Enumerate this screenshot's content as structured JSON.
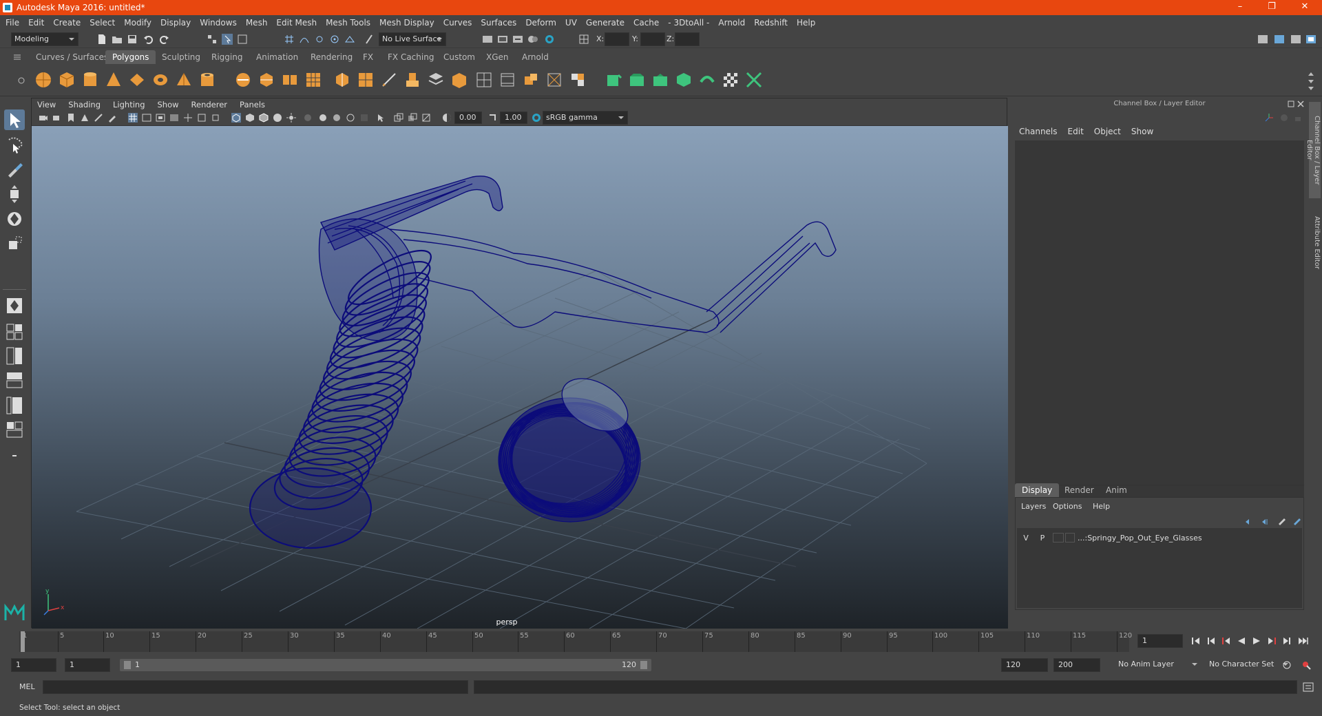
{
  "titlebar": {
    "title": "Autodesk Maya 2016: untitled*",
    "minimize": "–",
    "restore": "❐",
    "close": "✕"
  },
  "menus": [
    "File",
    "Edit",
    "Create",
    "Select",
    "Modify",
    "Display",
    "Windows",
    "Mesh",
    "Edit Mesh",
    "Mesh Tools",
    "Mesh Display",
    "Curves",
    "Surfaces",
    "Deform",
    "UV",
    "Generate",
    "Cache",
    "- 3DtoAll -",
    "Arnold",
    "Redshift",
    "Help"
  ],
  "status": {
    "mode": "Modeling",
    "live_surface": "No Live Surface",
    "x_label": "X:",
    "y_label": "Y:",
    "z_label": "Z:"
  },
  "shelf_tabs": [
    "Curves / Surfaces",
    "Polygons",
    "Sculpting",
    "Rigging",
    "Animation",
    "Rendering",
    "FX",
    "FX Caching",
    "Custom",
    "XGen",
    "Arnold"
  ],
  "shelf_active": "Polygons",
  "viewport": {
    "menus": [
      "View",
      "Shading",
      "Lighting",
      "Show",
      "Renderer",
      "Panels"
    ],
    "exposure": "0.00",
    "gamma": "1.00",
    "color_space": "sRGB gamma",
    "camera": "persp",
    "axis_y": "y",
    "axis_x": "x"
  },
  "channel_box": {
    "header": "Channel Box / Layer Editor",
    "menus": [
      "Channels",
      "Edit",
      "Object",
      "Show"
    ],
    "layer_tabs": [
      "Display",
      "Render",
      "Anim"
    ],
    "layer_menus": [
      "Layers",
      "Options",
      "Help"
    ],
    "layer": {
      "v": "V",
      "p": "P",
      "name": "...:Springy_Pop_Out_Eye_Glasses"
    }
  },
  "side_tabs": [
    "Channel Box / Layer Editor",
    "Attribute Editor"
  ],
  "timeline": {
    "ticks": [
      "1",
      "5",
      "10",
      "15",
      "20",
      "25",
      "30",
      "35",
      "40",
      "45",
      "50",
      "55",
      "60",
      "65",
      "70",
      "75",
      "80",
      "85",
      "90",
      "95",
      "100",
      "105",
      "110",
      "115",
      "120"
    ],
    "current_frame": "1"
  },
  "range": {
    "start": "1",
    "playback_start": "1",
    "slider_start": "1",
    "slider_end": "120",
    "playback_end": "120",
    "end": "200",
    "anim_layer": "No Anim Layer",
    "char_set": "No Character Set"
  },
  "mel": {
    "label": "MEL"
  },
  "help_line": "Select Tool: select an object",
  "colors": {
    "titlebar": "#e8470f",
    "wireframe": "#0c0c7a",
    "panel": "#444444"
  }
}
